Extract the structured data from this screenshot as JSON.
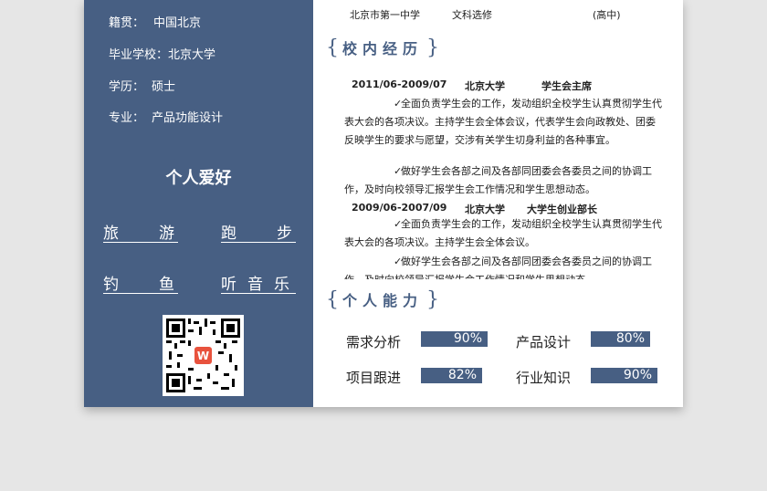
{
  "sidebar": {
    "info": [
      {
        "label": "籍贯：",
        "value": "中国北京"
      },
      {
        "label": "毕业学校：",
        "value": "北京大学"
      },
      {
        "label": "学历：",
        "value": "硕士"
      },
      {
        "label": "专业：",
        "value": "产品功能设计"
      }
    ],
    "hobby_title": "个人爱好",
    "hobbies": [
      "旅游",
      "跑步",
      "钓鱼",
      "听音乐"
    ]
  },
  "education": {
    "school": "北京市第一中学",
    "major": "文科选修",
    "level": "(高中)"
  },
  "campus": {
    "title": "校内经历",
    "jobs": [
      {
        "period": "2011/06-2009/07",
        "org": "北京大学",
        "role": "学生会主席",
        "items": [
          "全面负责学生会的工作，发动组织全校学生认真贯彻学生代表大会的各项决议。主持学生会全体会议，代表学生会向政教处、团委反映学生的要求与愿望，交涉有关学生切身利益的各种事宜。",
          "做好学生会各部之间及各部同团委会各委员之间的协调工作，及时向校领导汇报学生会工作情况和学生思想动态。"
        ]
      },
      {
        "period": "2009/06-2007/09",
        "org": "北京大学",
        "role": "大学生创业部长",
        "items": [
          "全面负责学生会的工作，发动组织全校学生认真贯彻学生代表大会的各项决议。主持学生会全体会议。",
          "做好学生会各部之间及各部同团委会各委员之间的协调工作，及时向校领导汇报学生会工作情况和学生思想动态。"
        ]
      }
    ]
  },
  "skills": {
    "title": "个人能力",
    "items": [
      {
        "name": "需求分析",
        "percent": 90,
        "label": "90%"
      },
      {
        "name": "产品设计",
        "percent": 80,
        "label": "80%"
      },
      {
        "name": "项目跟进",
        "percent": 82,
        "label": "82%"
      },
      {
        "name": "行业知识",
        "percent": 90,
        "label": "90%"
      }
    ]
  },
  "icons": {
    "check": "✓"
  },
  "colors": {
    "accent": "#475f83"
  }
}
